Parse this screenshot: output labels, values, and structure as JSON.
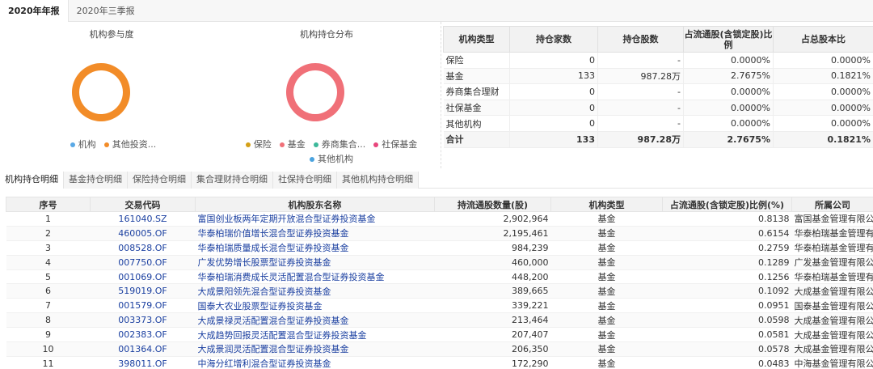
{
  "top_tabs": [
    "2020年年报",
    "2020年三季报"
  ],
  "charts": {
    "participation": {
      "title": "机构参与度",
      "legend": [
        {
          "label": "机构",
          "color": "#5aa9e6"
        },
        {
          "label": "其他投资...",
          "color": "#f28c28"
        }
      ]
    },
    "distribution": {
      "title": "机构持仓分布",
      "legend": [
        {
          "label": "保险",
          "color": "#d4a017"
        },
        {
          "label": "基金",
          "color": "#f07078"
        },
        {
          "label": "券商集合...",
          "color": "#3cb89a"
        },
        {
          "label": "社保基金",
          "color": "#e8467c"
        },
        {
          "label": "其他机构",
          "color": "#4aa3df"
        }
      ]
    }
  },
  "chart_data": [
    {
      "type": "pie",
      "title": "机构参与度",
      "labels": [
        "机构",
        "其他投资..."
      ],
      "values": [
        0,
        100
      ],
      "colors": [
        "#5aa9e6",
        "#f28c28"
      ]
    },
    {
      "type": "pie",
      "title": "机构持仓分布",
      "labels": [
        "保险",
        "基金",
        "券商集合...",
        "社保基金",
        "其他机构"
      ],
      "values": [
        0,
        100,
        0,
        0,
        0
      ],
      "colors": [
        "#d4a017",
        "#f07078",
        "#3cb89a",
        "#e8467c",
        "#4aa3df"
      ]
    }
  ],
  "summary": {
    "headers": [
      "机构类型",
      "持仓家数",
      "持仓股数",
      "占流通股(含锁定股)比例",
      "占总股本比"
    ],
    "rows": [
      [
        "保险",
        "0",
        "-",
        "0.0000%",
        "0.0000%"
      ],
      [
        "基金",
        "133",
        "987.28万",
        "2.7675%",
        "0.1821%"
      ],
      [
        "券商集合理财",
        "0",
        "-",
        "0.0000%",
        "0.0000%"
      ],
      [
        "社保基金",
        "0",
        "-",
        "0.0000%",
        "0.0000%"
      ],
      [
        "其他机构",
        "0",
        "-",
        "0.0000%",
        "0.0000%"
      ],
      [
        "合计",
        "133",
        "987.28万",
        "2.7675%",
        "0.1821%"
      ]
    ]
  },
  "sub_tabs": [
    "机构持仓明细",
    "基金持仓明细",
    "保险持仓明细",
    "集合理财持仓明细",
    "社保持仓明细",
    "其他机构持仓明细"
  ],
  "detail": {
    "headers": [
      "序号",
      "交易代码",
      "机构股东名称",
      "持流通股数量(股)",
      "机构类型",
      "占流通股(含锁定股)比例(%)",
      "所属公司"
    ],
    "rows": [
      [
        "1",
        "161040.SZ",
        "富国创业板两年定期开放混合型证券投资基金",
        "2,902,964",
        "基金",
        "0.8138",
        "富国基金管理有限公司"
      ],
      [
        "2",
        "460005.OF",
        "华泰柏瑞价值增长混合型证券投资基金",
        "2,195,461",
        "基金",
        "0.6154",
        "华泰柏瑞基金管理有限公司"
      ],
      [
        "3",
        "008528.OF",
        "华泰柏瑞质量成长混合型证券投资基金",
        "984,239",
        "基金",
        "0.2759",
        "华泰柏瑞基金管理有限公司"
      ],
      [
        "4",
        "007750.OF",
        "广发优势增长股票型证券投资基金",
        "460,000",
        "基金",
        "0.1289",
        "广发基金管理有限公司"
      ],
      [
        "5",
        "001069.OF",
        "华泰柏瑞消费成长灵活配置混合型证券投资基金",
        "448,200",
        "基金",
        "0.1256",
        "华泰柏瑞基金管理有限公司"
      ],
      [
        "6",
        "519019.OF",
        "大成景阳领先混合型证券投资基金",
        "389,665",
        "基金",
        "0.1092",
        "大成基金管理有限公司"
      ],
      [
        "7",
        "001579.OF",
        "国泰大农业股票型证券投资基金",
        "339,221",
        "基金",
        "0.0951",
        "国泰基金管理有限公司"
      ],
      [
        "8",
        "003373.OF",
        "大成景禄灵活配置混合型证券投资基金",
        "213,464",
        "基金",
        "0.0598",
        "大成基金管理有限公司"
      ],
      [
        "9",
        "002383.OF",
        "大成趋势回报灵活配置混合型证券投资基金",
        "207,407",
        "基金",
        "0.0581",
        "大成基金管理有限公司"
      ],
      [
        "10",
        "001364.OF",
        "大成景润灵活配置混合型证券投资基金",
        "206,350",
        "基金",
        "0.0578",
        "大成基金管理有限公司"
      ],
      [
        "11",
        "398011.OF",
        "中海分红增利混合型证券投资基金",
        "172,290",
        "基金",
        "0.0483",
        "中海基金管理有限公司"
      ]
    ]
  }
}
